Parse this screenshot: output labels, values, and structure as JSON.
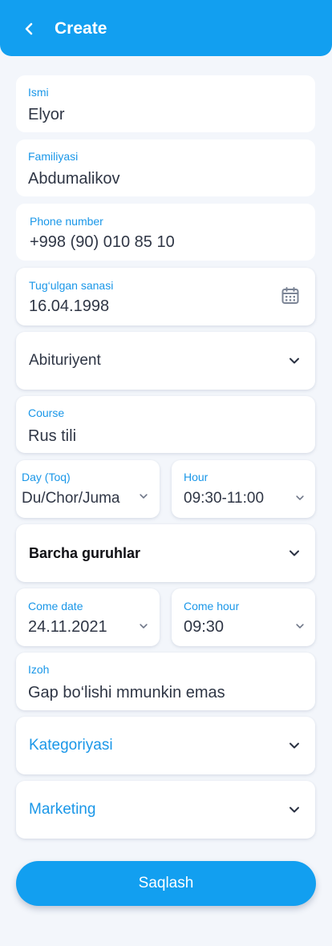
{
  "header": {
    "title": "Create",
    "back_icon": "chevron-left-icon"
  },
  "colors": {
    "accent": "#129ff0",
    "label": "#1a97e8",
    "background": "#f3f6fb"
  },
  "form": {
    "first_name": {
      "label": "Ismi",
      "value": "Elyor"
    },
    "last_name": {
      "label": "Familiyasi",
      "value": "Abdumalikov"
    },
    "phone": {
      "label": "Phone number",
      "value": "+998 (90) 010 85 10"
    },
    "birth_date": {
      "label": "Tug‘ulgan sanasi",
      "value": "16.04.1998",
      "icon": "calendar-icon"
    },
    "status": {
      "value": "Abituriyent"
    },
    "course": {
      "label": "Course",
      "value": "Rus tili"
    },
    "day": {
      "label": "Day (Toq)",
      "value": "Du/Chor/Juma"
    },
    "hour": {
      "label": "Hour",
      "value": "09:30-11:00"
    },
    "group": {
      "value": "Barcha guruhlar"
    },
    "come_date": {
      "label": "Come date",
      "value": "24.11.2021"
    },
    "come_hour": {
      "label": "Come hour",
      "value": "09:30"
    },
    "note": {
      "label": "Izoh",
      "value": "Gap bo‘lishi mmunkin emas"
    },
    "category": {
      "placeholder": "Kategoriyasi"
    },
    "marketing": {
      "placeholder": "Marketing"
    }
  },
  "save_button": {
    "label": "Saqlash"
  }
}
